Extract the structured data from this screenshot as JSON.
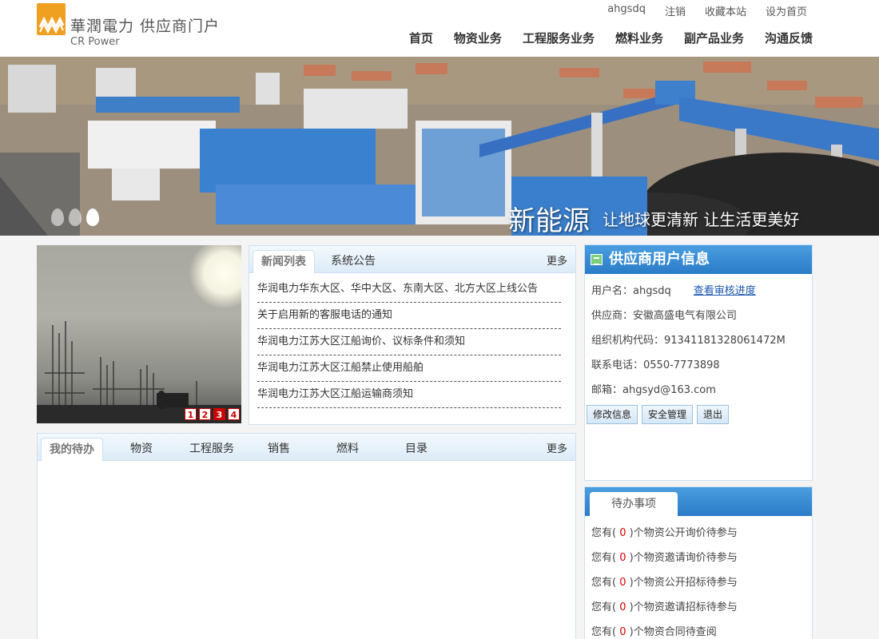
{
  "header": {
    "logo_cn": "華潤電力 供应商门户",
    "logo_en": "CR Power",
    "toplinks": [
      "ahgsdq",
      "注销",
      "收藏本站",
      "设为首页"
    ],
    "nav": [
      "首页",
      "物资业务",
      "工程服务业务",
      "燃料业务",
      "副产品业务",
      "沟通反馈"
    ]
  },
  "banner": {
    "slogan_big": "新能源",
    "slogan_small": "让地球更清新  让生活更美好"
  },
  "slideshow": {
    "numbers": [
      "1",
      "2",
      "3",
      "4"
    ],
    "active_index": 3
  },
  "news": {
    "tabs": [
      "新闻列表",
      "系统公告"
    ],
    "more": "更多",
    "items": [
      "华润电力华东大区、华中大区、东南大区、北方大区上线公告",
      "关于启用新的客服电话的通知",
      "华润电力江苏大区江船询价、议标条件和须知",
      "华润电力江苏大区江船禁止使用船舶",
      "华润电力江苏大区江船运输商须知"
    ]
  },
  "todo_panel": {
    "tabs": [
      "我的待办",
      "物资",
      "工程服务",
      "销售",
      "燃料",
      "目录"
    ],
    "more": "更多"
  },
  "supplier": {
    "title": "供应商用户信息",
    "username": "用户名：ahgsdq",
    "check_link": "查看审核进度",
    "company": "供应商：安徽高盛电气有限公司",
    "org_code": "组织机构代码：91341181328061472M",
    "phone": "联系电话：0550-7773898",
    "email": "邮箱：ahgsyd@163.com",
    "buttons": [
      "修改信息",
      "安全管理",
      "退出"
    ]
  },
  "pending": {
    "title": "待办事项",
    "items": [
      {
        "prefix": "您有(",
        "count": " 0 ",
        "suffix": ")个物资公开询价待参与"
      },
      {
        "prefix": "您有(",
        "count": " 0 ",
        "suffix": ")个物资邀请询价待参与"
      },
      {
        "prefix": "您有(",
        "count": " 0 ",
        "suffix": ")个物资公开招标待参与"
      },
      {
        "prefix": "您有(",
        "count": " 0 ",
        "suffix": ")个物资邀请招标待参与"
      },
      {
        "prefix": "您有(",
        "count": " 0 ",
        "suffix": ")个物资合同待查阅"
      }
    ]
  }
}
